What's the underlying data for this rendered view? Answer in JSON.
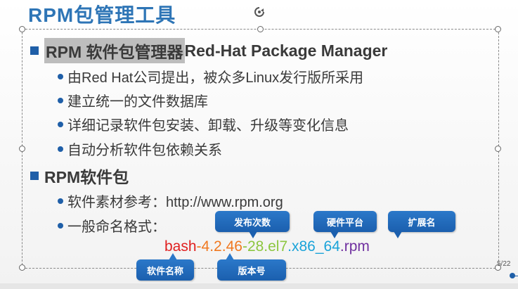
{
  "slide": {
    "title": "RPM包管理工具",
    "page_number": "5/22"
  },
  "section1": {
    "heading_highlight": "RPM 软件包管理器",
    "heading_rest": "Red-Hat Package Manager",
    "bullets": [
      "由Red Hat公司提出，被众多Linux发行版所采用",
      "建立统一的文件数据库",
      "详细记录软件包安装、卸载、升级等变化信息",
      "自动分析软件包依赖关系"
    ]
  },
  "section2": {
    "heading": "RPM软件包",
    "bullets": [
      "软件素材参考：http://www.rpm.org",
      "一般命名格式："
    ]
  },
  "package_name": {
    "name": "bash",
    "sep1": "-",
    "version": "4.2.46",
    "sep2": "-",
    "release": "28.el7",
    "sep3": ".",
    "arch": "x86_64",
    "ext": ".rpm"
  },
  "callouts": {
    "release": "发布次数",
    "arch": "硬件平台",
    "ext": "扩展名",
    "name": "软件名称",
    "version": "版本号"
  },
  "colors": {
    "title": "#2e75b6",
    "name": "#e02020",
    "version": "#f07820",
    "release": "#8cc63f",
    "arch": "#1aa3d9",
    "ext": "#7030a0",
    "callout": "#1f6ec0"
  }
}
